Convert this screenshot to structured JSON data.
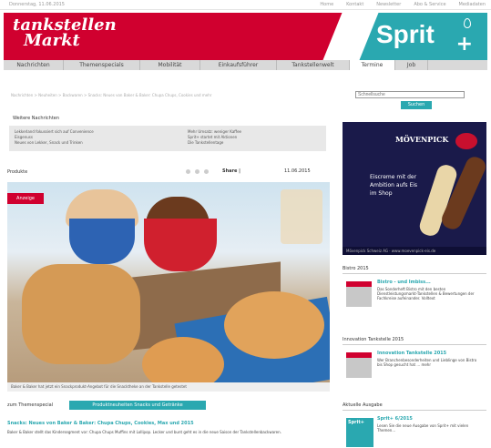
{
  "topbar": {
    "date": "Donnerstag, 11.06.2015",
    "links": [
      "Home",
      "Kontakt",
      "Newsletter",
      "Abo & Service",
      "Mediadaten"
    ]
  },
  "header": {
    "logo_line1": "tankstellen",
    "logo_line2": "Markt",
    "sprit_logo": "Sprit",
    "sprit_plus": "+"
  },
  "nav": {
    "items": [
      "Nachrichten",
      "Themenspecials",
      "Mobilität",
      "Einkaufsführer",
      "Tankstellenwelt",
      "Termine",
      "Job"
    ],
    "active_index": 5
  },
  "breadcrumb": "Nachrichten > Neuheiten > Backwaren > Snacks: Neues von Baker & Baker: Chupa Chups, Cookies und mehr",
  "search": {
    "placeholder": "Schnellsuche",
    "button": "Suchen"
  },
  "more_news": {
    "title": "Weitere Nachrichten",
    "col1": [
      "Lekkerland fokussiert sich auf Convenience",
      "Eisgenuss",
      "Neues von Lekker, Snack und Trinken"
    ],
    "col2": [
      "Mehr Umsatz: weniger Kaffee",
      "Sprit+ startet mit Aktionen",
      "Die Tankstellentage"
    ]
  },
  "products": {
    "label": "Produkte",
    "share": "Share |",
    "date": "11.06.2015"
  },
  "hero": {
    "ad_tag": "Anzeige",
    "caption": "Baker & Baker hat jetzt ein Snackprodukt-Angebot für die Snacktheke an der Tankstelle getestet"
  },
  "topic": {
    "label": "zum Themenspecial",
    "pill": "Produktneuheiten Snacks und Getränke"
  },
  "article": {
    "title": "Snacks: Neues von Baker & Baker: Chupa Chups, Cookies, Max und 2015",
    "text": "Baker & Baker stellt das Kindersegment vor: Chupa Chups Muffins mit Lollipop. Lecker und bunt geht es in die neue Saison der Tankstellenbackwaren."
  },
  "right_ad": {
    "brand": "MÖVENPICK",
    "tagline": "Eiscreme mit der Ambition aufs Eis im Shop",
    "footer": "Mövenpick Schweiz AG · www.moevenpick-eis.de"
  },
  "sidebar": {
    "section1": {
      "head": "Bistro 2015",
      "title": "Bistro - und Imbiss...",
      "text": "Das Sonderheft Bistro mit den besten Dienstleistungsmarkt-Tankstellen & Bewertungen der Fachkreise aufeinander. Volltext"
    },
    "section2": {
      "head": "Innovation Tankstelle 2015",
      "title": "Innovation Tankstelle 2015",
      "text": "Wer Branchenbesonderheiten und Lieblinge von Bistro bis Shop gesucht hat ... mehr"
    },
    "section3": {
      "head": "Aktuelle Ausgabe",
      "thumb": "Sprit+",
      "title": "Sprit+ 6/2015",
      "text": "Lesen Sie die neue Ausgabe von Sprit+ mit vielen Themen..."
    }
  }
}
